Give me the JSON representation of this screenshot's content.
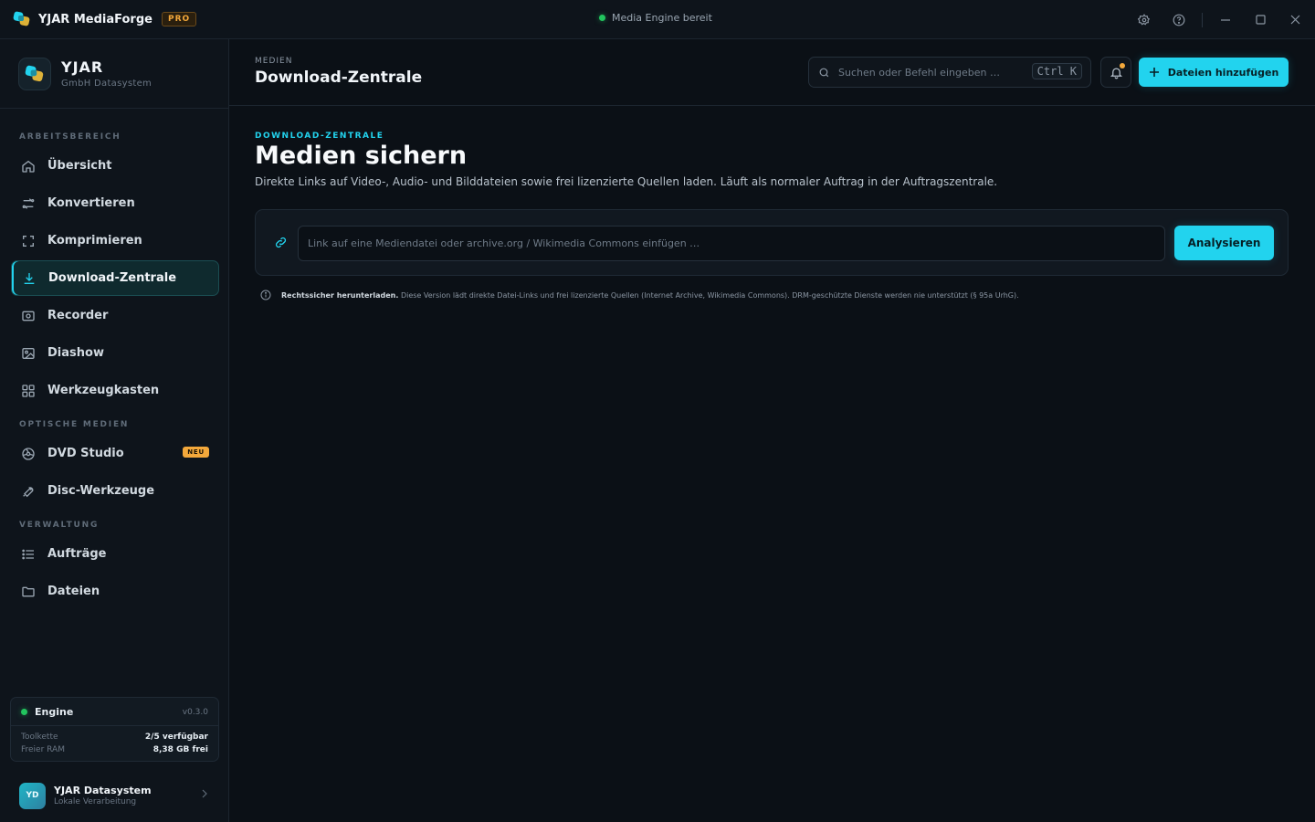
{
  "app": {
    "title": "YJAR MediaForge",
    "badge": "PRO",
    "status": "Media Engine bereit"
  },
  "brand": {
    "name": "YJAR",
    "sub": "GmbH Datasystem"
  },
  "sidebar": {
    "sections": [
      "ARBEITSBEREICH",
      "OPTISCHE MEDIEN",
      "VERWALTUNG"
    ],
    "items": [
      {
        "label": "Übersicht",
        "icon": "home-icon"
      },
      {
        "label": "Konvertieren",
        "icon": "convert-icon"
      },
      {
        "label": "Komprimieren",
        "icon": "compress-icon"
      },
      {
        "label": "Download-Zentrale",
        "icon": "download-icon",
        "active": true
      },
      {
        "label": "Recorder",
        "icon": "record-icon"
      },
      {
        "label": "Diashow",
        "icon": "image-icon"
      },
      {
        "label": "Werkzeugkasten",
        "icon": "grid-icon"
      },
      {
        "label": "DVD Studio",
        "icon": "disc-icon",
        "badge": "NEU"
      },
      {
        "label": "Disc-Werkzeuge",
        "icon": "tool-icon"
      },
      {
        "label": "Aufträge",
        "icon": "list-icon"
      },
      {
        "label": "Dateien",
        "icon": "folder-icon"
      }
    ]
  },
  "engine": {
    "title": "Engine",
    "version": "v0.3.0",
    "toolchain_label": "Toolkette",
    "toolchain_value": "2/5 verfügbar",
    "ram_label": "Freier RAM",
    "ram_value": "8,38 GB frei"
  },
  "user": {
    "initials": "YD",
    "name": "YJAR Datasystem",
    "sub": "Lokale Verarbeitung"
  },
  "header": {
    "crumb": "MEDIEN",
    "title": "Download-Zentrale",
    "search_placeholder": "Suchen oder Befehl eingeben …",
    "shortcut": "Ctrl K",
    "add_label": "Dateien hinzufügen"
  },
  "content": {
    "eyebrow": "DOWNLOAD-ZENTRALE",
    "title": "Medien sichern",
    "subtitle": "Direkte Links auf Video-, Audio- und Bilddateien sowie frei lizenzierte Quellen laden. Läuft als normaler Auftrag in der Auftragszentrale.",
    "url_placeholder": "Link auf eine Mediendatei oder archive.org / Wikimedia Commons einfügen …",
    "analyze_label": "Analysieren",
    "notice_bold": "Rechtssicher herunterladen.",
    "notice_text": "Diese Version lädt direkte Datei-Links und frei lizenzierte Quellen (Internet Archive, Wikimedia Commons). DRM-geschützte Dienste werden nie unterstützt (§ 95a UrhG)."
  },
  "colors": {
    "accent": "#22d3ee",
    "warning": "#f3a83b",
    "success": "#22c55e",
    "background": "#0b1016"
  }
}
